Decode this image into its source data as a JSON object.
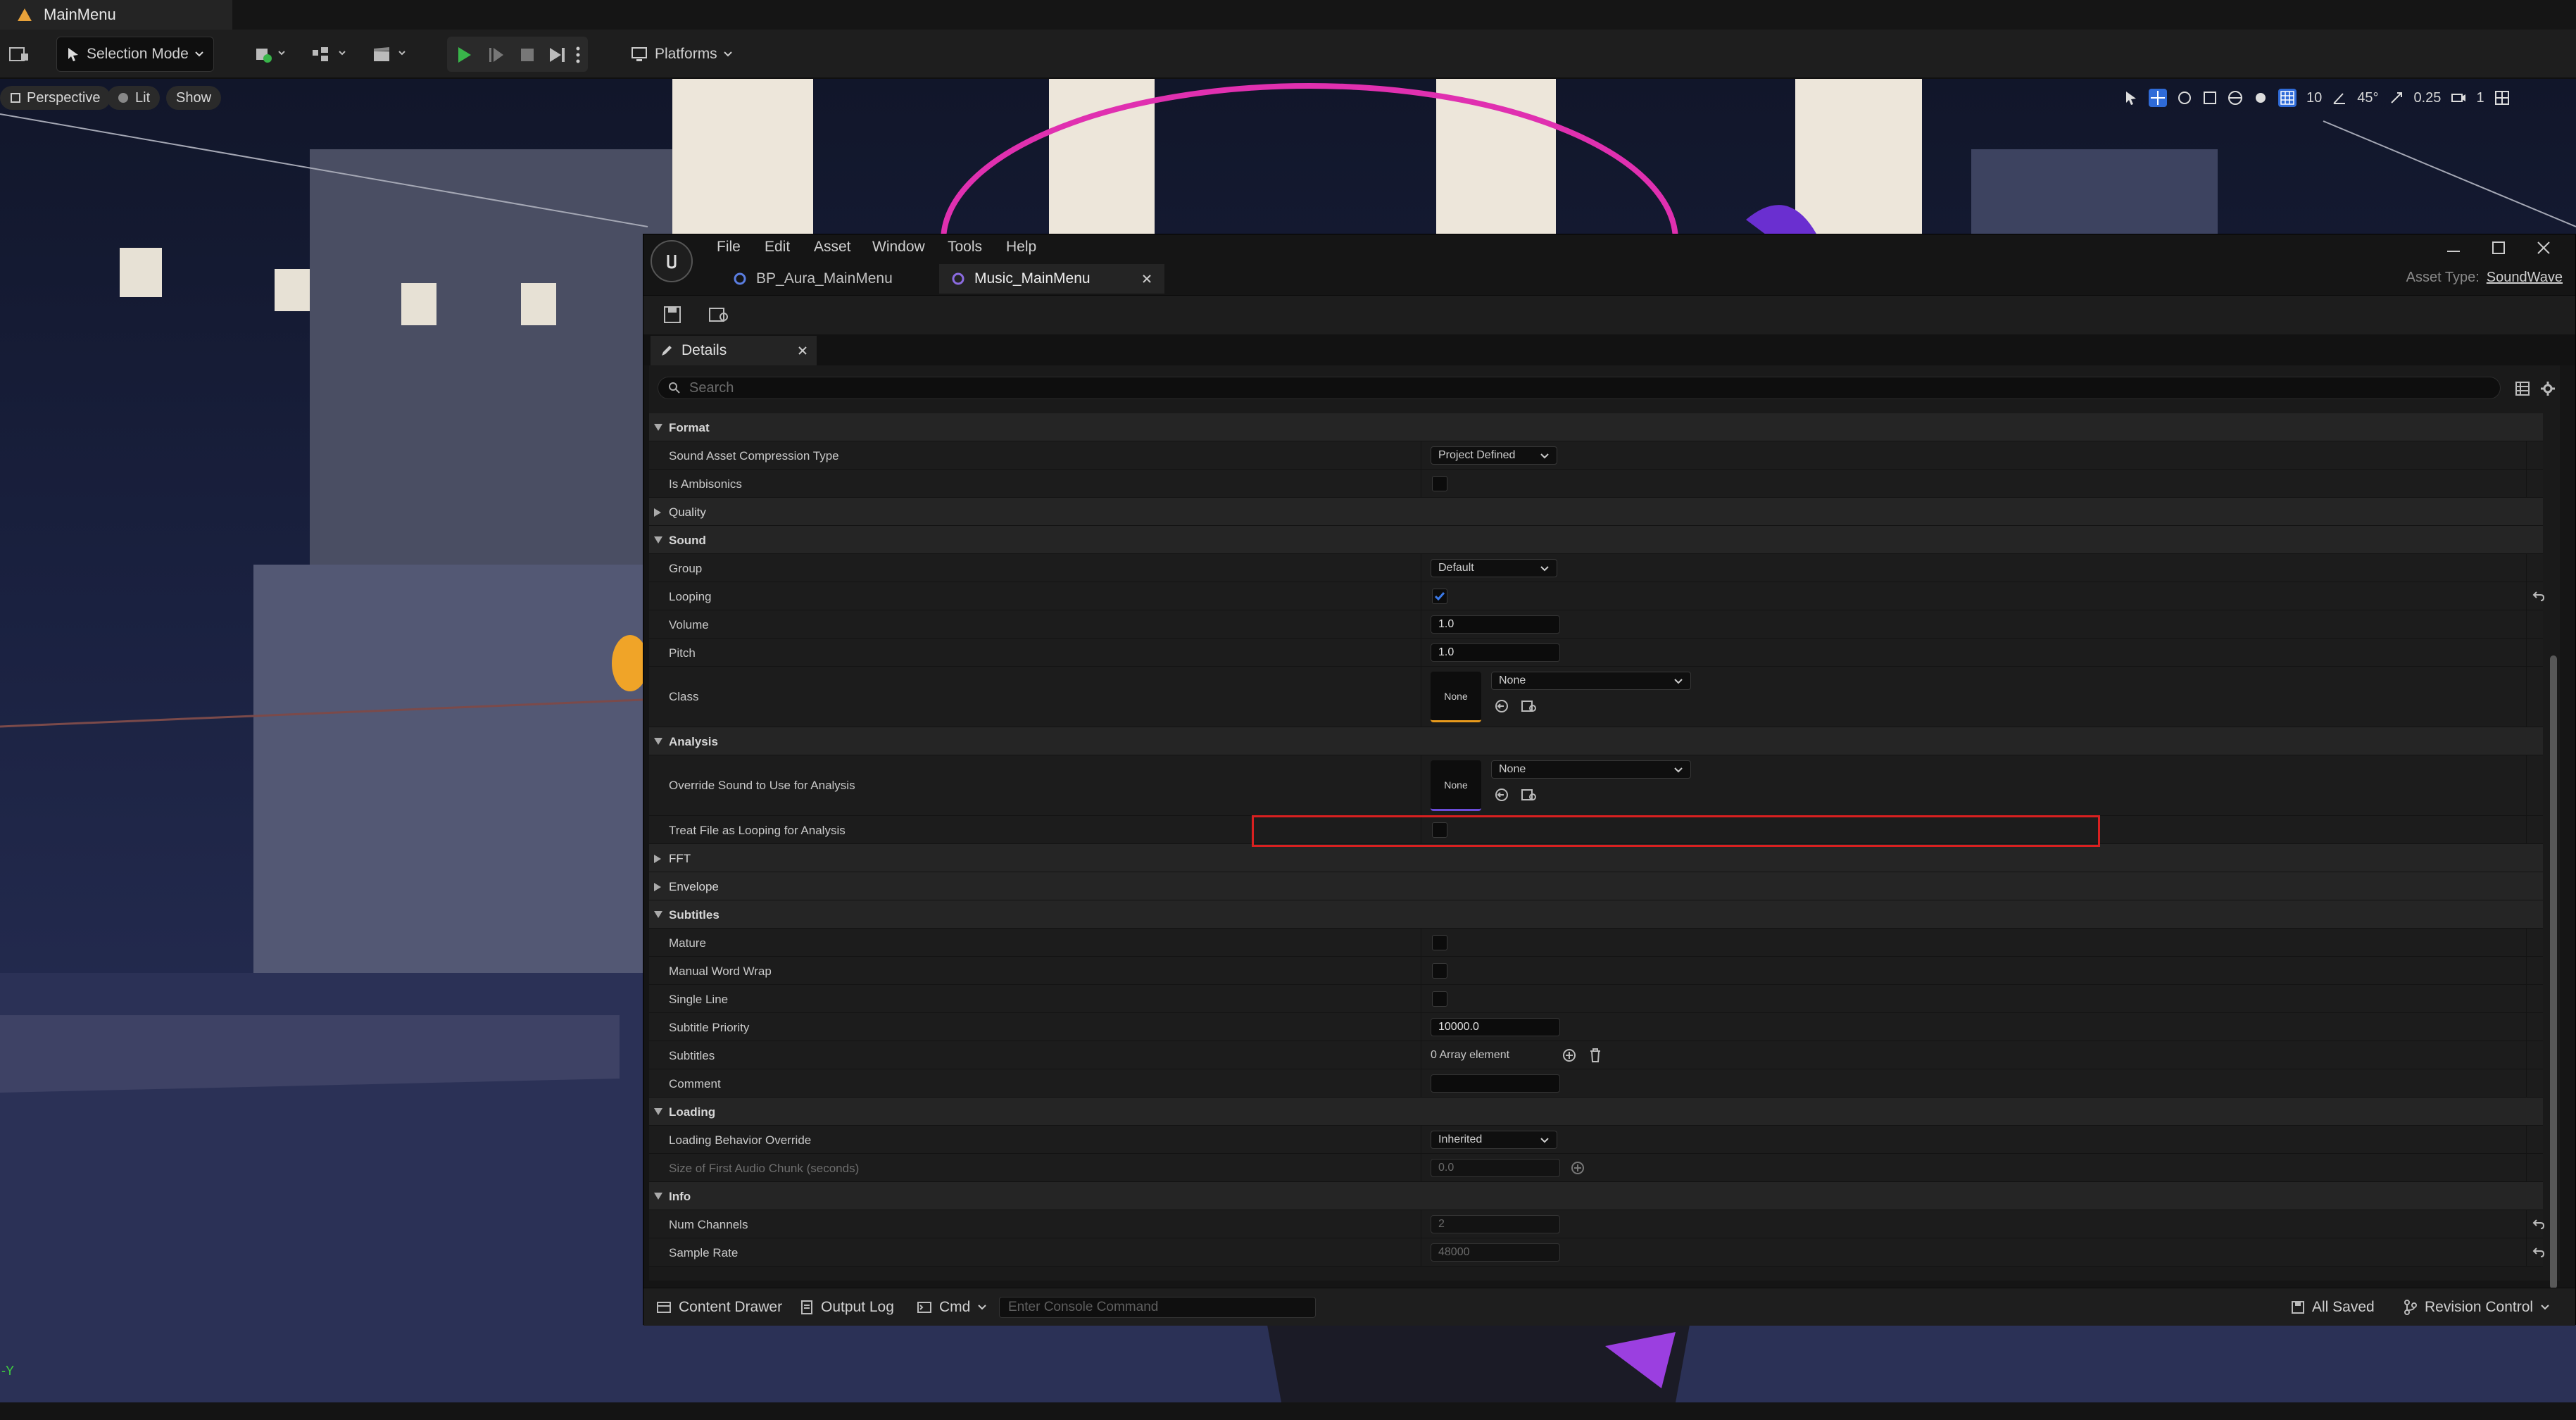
{
  "level": {
    "tab_title": "MainMenu"
  },
  "toolbar": {
    "selection_mode": "Selection Mode",
    "platforms": "Platforms"
  },
  "viewport": {
    "perspective": "Perspective",
    "lit": "Lit",
    "show": "Show",
    "grid_snap": "10",
    "rotation_snap": "45°",
    "scale_snap": "0.25",
    "camera_speed": "1",
    "axis_label": "-Y"
  },
  "asset_window": {
    "menu": [
      "File",
      "Edit",
      "Asset",
      "Window",
      "Tools",
      "Help"
    ],
    "tabs": [
      "BP_Aura_MainMenu",
      "Music_MainMenu"
    ],
    "asset_type_label": "Asset Type:",
    "asset_type_value": "SoundWave",
    "details_tab": "Details",
    "search_placeholder": "Search"
  },
  "details": {
    "format": {
      "header": "Format",
      "compression_label": "Sound Asset Compression Type",
      "compression_value": "Project Defined",
      "ambisonics_label": "Is Ambisonics",
      "ambisonics_checked": false
    },
    "quality": {
      "header": "Quality"
    },
    "sound": {
      "header": "Sound",
      "group_label": "Group",
      "group_value": "Default",
      "looping_label": "Looping",
      "looping_checked": true,
      "volume_label": "Volume",
      "volume_value": "1.0",
      "pitch_label": "Pitch",
      "pitch_value": "1.0",
      "class_label": "Class",
      "class_thumb": "None",
      "class_value": "None"
    },
    "analysis": {
      "header": "Analysis",
      "override_label": "Override Sound to Use for Analysis",
      "override_thumb": "None",
      "override_value": "None",
      "treat_looping_label": "Treat File as Looping for Analysis",
      "treat_looping_checked": false
    },
    "fft": {
      "header": "FFT"
    },
    "envelope": {
      "header": "Envelope"
    },
    "subtitles": {
      "header": "Subtitles",
      "mature_label": "Mature",
      "manual_wrap_label": "Manual Word Wrap",
      "single_line_label": "Single Line",
      "priority_label": "Subtitle Priority",
      "priority_value": "10000.0",
      "subtitles_label": "Subtitles",
      "subtitles_value": "0 Array element",
      "comment_label": "Comment",
      "comment_value": ""
    },
    "loading": {
      "header": "Loading",
      "behavior_label": "Loading Behavior Override",
      "behavior_value": "Inherited",
      "chunk_label": "Size of First Audio Chunk (seconds)",
      "chunk_value": "0.0"
    },
    "info": {
      "header": "Info",
      "channels_label": "Num Channels",
      "channels_value": "2",
      "sample_rate_label": "Sample Rate",
      "sample_rate_value": "48000"
    }
  },
  "bottom_bar": {
    "content_drawer": "Content Drawer",
    "output_log": "Output Log",
    "cmd": "Cmd",
    "console_placeholder": "Enter Console Command",
    "all_saved": "All Saved",
    "revision_control": "Revision Control"
  },
  "colors": {
    "accent_blue": "#2f6bd8",
    "play_green": "#39b54a",
    "highlight_red": "#d92020",
    "sound_class_orange": "#e89a1c",
    "analysis_purple": "#6a4cd8"
  }
}
